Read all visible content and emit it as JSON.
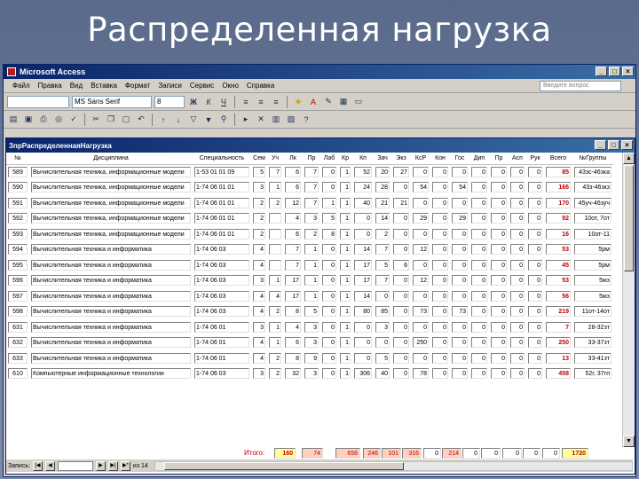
{
  "slide": {
    "title": "Распределенная нагрузка"
  },
  "app": {
    "title": "Microsoft Access",
    "menu": [
      "Файл",
      "Правка",
      "Вид",
      "Вставка",
      "Формат",
      "Записи",
      "Сервис",
      "Окно",
      "Справка"
    ],
    "help_placeholder": "Введите вопрос",
    "toolbar": {
      "font": "MS Sans Serif",
      "size": "8"
    }
  },
  "query": {
    "title": "ЗпрРаспределеннаяНагрузка",
    "columns": [
      "№",
      "Дисциплина",
      "Специальность",
      "Сем",
      "Уч",
      "Лк",
      "Пр",
      "Лаб",
      "Кр",
      "Кп",
      "Зач",
      "Экз",
      "КсР",
      "Кон",
      "Гос",
      "Дип",
      "Пр",
      "Асп",
      "Рук",
      "Всего",
      "№Группы"
    ],
    "rows": [
      [
        "589",
        "Вычислительная техника, информационные модели",
        "1-53 01 01 09",
        "5",
        "7",
        "6",
        "7",
        "0",
        "1",
        "52",
        "20",
        "27",
        "0",
        "0",
        "0",
        "0",
        "0",
        "0",
        "0",
        "85",
        "43зс-46зка"
      ],
      [
        "590",
        "Вычислительная техника, информационные модели",
        "1-74 06 01 01",
        "3",
        "1",
        "6",
        "7",
        "0",
        "1",
        "24",
        "28",
        "0",
        "54",
        "0",
        "54",
        "0",
        "0",
        "0",
        "0",
        "166",
        "43з-46зкз"
      ],
      [
        "591",
        "Вычислительная техника, информационные модели",
        "1-74 06 01 01",
        "2",
        "2",
        "12",
        "7",
        "1",
        "1",
        "40",
        "21",
        "21",
        "0",
        "0",
        "0",
        "0",
        "0",
        "0",
        "0",
        "170",
        "45уч-46зуч"
      ],
      [
        "592",
        "Вычислительная техника, информационные модели",
        "1-74 06 01 01",
        "2",
        "",
        "4",
        "3",
        "5",
        "1",
        "0",
        "14",
        "0",
        "29",
        "0",
        "29",
        "0",
        "0",
        "0",
        "0",
        "92",
        "10от, 7от"
      ],
      [
        "593",
        "Вычислительная техника, информационные модели",
        "1-74 06 01 01",
        "2",
        "",
        "6",
        "2",
        "8",
        "1",
        "0",
        "2",
        "0",
        "0",
        "0",
        "0",
        "0",
        "0",
        "0",
        "0",
        "16",
        "10от-11"
      ],
      [
        "594",
        "Вычислительная техника и информатика",
        "1-74 06 03",
        "4",
        "",
        "7",
        "1",
        "0",
        "1",
        "14",
        "7",
        "0",
        "12",
        "0",
        "0",
        "0",
        "0",
        "0",
        "0",
        "53",
        "5рм"
      ],
      [
        "595",
        "Вычислительная техника и информатика",
        "1-74 06 03",
        "4",
        "",
        "7",
        "1",
        "0",
        "1",
        "17",
        "5",
        "6",
        "0",
        "0",
        "0",
        "0",
        "0",
        "0",
        "0",
        "45",
        "5рм"
      ],
      [
        "596",
        "Вычислительная техника и информатика",
        "1-74 06 03",
        "3",
        "1",
        "17",
        "1",
        "0",
        "1",
        "17",
        "7",
        "0",
        "12",
        "0",
        "0",
        "0",
        "0",
        "0",
        "0",
        "53",
        "5мз"
      ],
      [
        "597",
        "Вычислительная техника и информатика",
        "1-74 06 03",
        "4",
        "4",
        "17",
        "1",
        "0",
        "1",
        "14",
        "0",
        "0",
        "0",
        "0",
        "0",
        "0",
        "0",
        "0",
        "0",
        "56",
        "5мз"
      ],
      [
        "598",
        "Вычислительная техника и информатика",
        "1-74 06 03",
        "4",
        "2",
        "8",
        "5",
        "0",
        "1",
        "80",
        "85",
        "0",
        "73",
        "0",
        "73",
        "0",
        "0",
        "0",
        "0",
        "219",
        "11от-14от"
      ],
      [
        "631",
        "Вычислительная техника и информатика",
        "1-74 06 01",
        "3",
        "1",
        "4",
        "3",
        "0",
        "1",
        "0",
        "3",
        "0",
        "0",
        "0",
        "0",
        "0",
        "0",
        "0",
        "0",
        "7",
        "28-32зт"
      ],
      [
        "632",
        "Вычислительная техника и информатика",
        "1-74 06 01",
        "4",
        "1",
        "6",
        "3",
        "0",
        "1",
        "0",
        "0",
        "0",
        "250",
        "0",
        "0",
        "0",
        "0",
        "0",
        "0",
        "250",
        "33-37зт"
      ],
      [
        "633",
        "Вычислительная техника и информатика",
        "1-74 06 01",
        "4",
        "2",
        "8",
        "9",
        "0",
        "1",
        "0",
        "5",
        "0",
        "0",
        "0",
        "0",
        "0",
        "0",
        "0",
        "0",
        "13",
        "33-41зт"
      ],
      [
        "610",
        "Компьютерные информационные технологии",
        "1-74 06 03",
        "3",
        "2",
        "32",
        "3",
        "0",
        "1",
        "306",
        "40",
        "0",
        "78",
        "0",
        "0",
        "0",
        "0",
        "0",
        "0",
        "458",
        "52г, 37гп"
      ]
    ],
    "totals_label": "Итого:",
    "totals": [
      "160",
      "74",
      "658",
      "246",
      "101",
      "316",
      "0",
      "214",
      "0",
      "0",
      "0",
      "0",
      "0",
      "1720"
    ],
    "nav": {
      "record_label": "Запись:",
      "of_count": "из 14"
    }
  }
}
